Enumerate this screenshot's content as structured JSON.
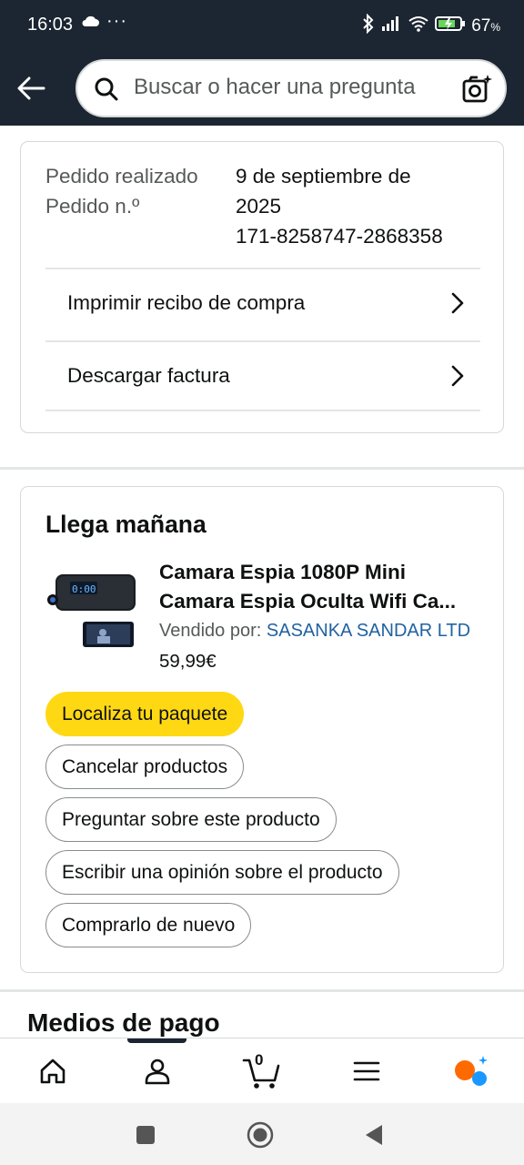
{
  "status_bar": {
    "time": "16:03",
    "dots": "···",
    "battery_percent": "67",
    "battery_unit": "%"
  },
  "header": {
    "search_placeholder": "Buscar o hacer una pregunta"
  },
  "order": {
    "placed_label": "Pedido realizado",
    "placed_value_line1": "9 de septiembre de",
    "placed_value_line2": "2025",
    "number_label": "Pedido n.º",
    "number_value": "171-8258747-2868358",
    "links": [
      "Imprimir recibo de compra",
      "Descargar factura"
    ]
  },
  "delivery": {
    "title": "Llega mañana",
    "product_title_line1": "Camara Espia 1080P Mini",
    "product_title_line2": "Camara Espia Oculta Wifi Ca...",
    "sold_by_label": "Vendido por:",
    "seller": "SASANKA SANDAR LTD",
    "price": "59,99€",
    "buttons": [
      "Localiza tu paquete",
      "Cancelar productos",
      "Preguntar sobre este producto",
      "Escribir una opinión sobre el producto",
      "Comprarlo de nuevo"
    ]
  },
  "payment_section_title": "Medios de pago",
  "bottom_nav": {
    "cart_count": "0",
    "items": [
      "home-icon",
      "account-icon",
      "cart-icon",
      "menu-icon",
      "rufus-icon"
    ]
  },
  "colors": {
    "dark_header": "#1c2632",
    "primary_button": "#ffd814",
    "link": "#2162a1",
    "rufus_orange": "#ff6a00",
    "rufus_blue": "#1a98ff"
  }
}
